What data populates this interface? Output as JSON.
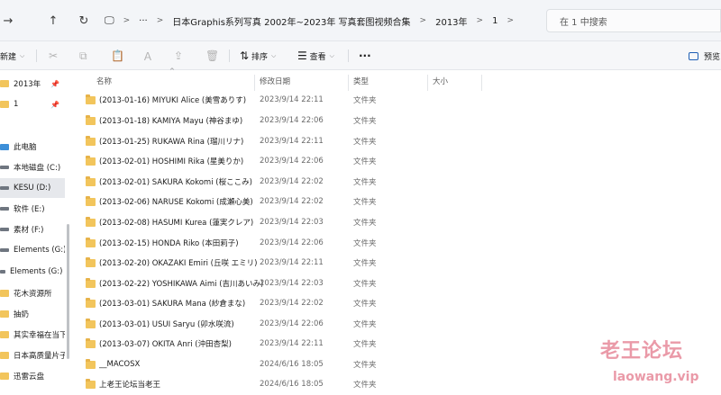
{
  "address": {
    "crumbs": [
      "日本Graphis系列写真 2002年~2023年 写真套图视频合集",
      "2013年",
      "1"
    ],
    "search_placeholder": "在 1 中搜索"
  },
  "toolbar": {
    "new_label": "新建",
    "sort_label": "排序",
    "view_label": "查看",
    "more_label": "···",
    "preview_label": "预览"
  },
  "sidebar": {
    "items": [
      {
        "label": "2013年",
        "kind": "folder",
        "pinned": true
      },
      {
        "label": "1",
        "kind": "folder",
        "pinned": true
      },
      {
        "label": "此电脑",
        "kind": "pc"
      },
      {
        "label": "本地磁盘 (C:)",
        "kind": "drive"
      },
      {
        "label": "KESU (D:)",
        "kind": "drive",
        "active": true
      },
      {
        "label": "软件 (E:)",
        "kind": "drive"
      },
      {
        "label": "素材 (F:)",
        "kind": "drive"
      },
      {
        "label": "Elements (G:)",
        "kind": "drive"
      },
      {
        "label": "Elements (G:)",
        "kind": "drive"
      },
      {
        "label": "花木资源所",
        "kind": "folder"
      },
      {
        "label": "抽奶",
        "kind": "folder"
      },
      {
        "label": "其实幸福在当下",
        "kind": "folder"
      },
      {
        "label": "日本高质量片子",
        "kind": "folder"
      },
      {
        "label": "迅雷云盘",
        "kind": "folder"
      }
    ]
  },
  "columns": {
    "name": "名称",
    "date": "修改日期",
    "type": "类型",
    "size": "大小"
  },
  "files": [
    {
      "name": "(2013-01-16) MIYUKI Alice (美雪ありす)",
      "date": "2023/9/14 22:11",
      "type": "文件夹"
    },
    {
      "name": "(2013-01-18) KAMIYA Mayu (神谷まゆ)",
      "date": "2023/9/14 22:06",
      "type": "文件夹"
    },
    {
      "name": "(2013-01-25) RUKAWA Rina (瑠川リナ)",
      "date": "2023/9/14 22:11",
      "type": "文件夹"
    },
    {
      "name": "(2013-02-01) HOSHIMI Rika (星美りか)",
      "date": "2023/9/14 22:06",
      "type": "文件夹"
    },
    {
      "name": "(2013-02-01) SAKURA Kokomi (桜ここみ)",
      "date": "2023/9/14 22:02",
      "type": "文件夹"
    },
    {
      "name": "(2013-02-06) NARUSE Kokomi (成瀬心美)",
      "date": "2023/9/14 22:02",
      "type": "文件夹"
    },
    {
      "name": "(2013-02-08) HASUMI Kurea (蓮実クレア)",
      "date": "2023/9/14 22:03",
      "type": "文件夹"
    },
    {
      "name": "(2013-02-15) HONDA Riko (本田莉子)",
      "date": "2023/9/14 22:06",
      "type": "文件夹"
    },
    {
      "name": "(2013-02-20) OKAZAKI Emiri (丘咲 エミリ)",
      "date": "2023/9/14 22:11",
      "type": "文件夹"
    },
    {
      "name": "(2013-02-22) YOSHIKAWA Aimi (吉川あいみ)",
      "date": "2023/9/14 22:03",
      "type": "文件夹"
    },
    {
      "name": "(2013-03-01) SAKURA Mana (紗倉まな)",
      "date": "2023/9/14 22:02",
      "type": "文件夹"
    },
    {
      "name": "(2013-03-01) USUI Saryu (卯水咲流)",
      "date": "2023/9/14 22:06",
      "type": "文件夹"
    },
    {
      "name": "(2013-03-07) OKITA Anri (沖田杏梨)",
      "date": "2023/9/14 22:11",
      "type": "文件夹"
    },
    {
      "name": "__MACOSX",
      "date": "2024/6/16 18:05",
      "type": "文件夹"
    },
    {
      "name": "上老王论坛当老王",
      "date": "2024/6/16 18:05",
      "type": "文件夹"
    }
  ],
  "watermark": {
    "text": "老王论坛",
    "url": "laowang.vip"
  },
  "colors": {
    "folder": "#f2c55c",
    "watermark": "#ea9aa8"
  }
}
